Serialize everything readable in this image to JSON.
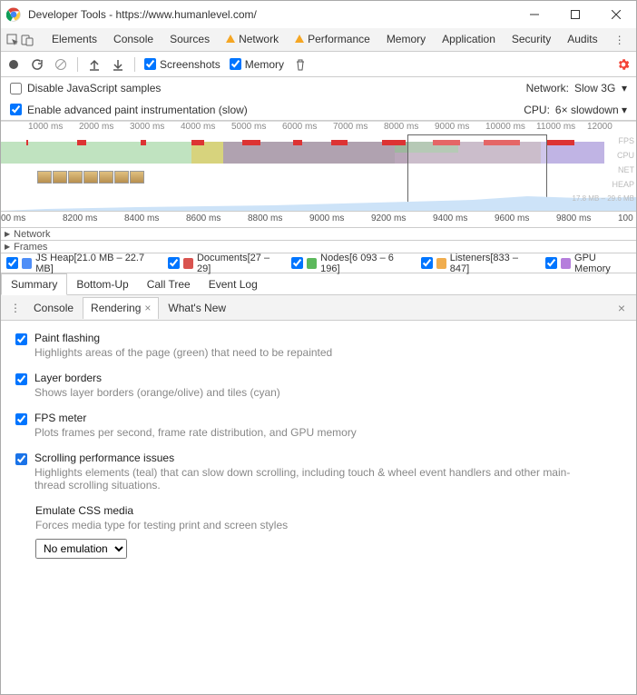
{
  "window": {
    "title": "Developer Tools - https://www.humanlevel.com/"
  },
  "mainTabs": [
    "Elements",
    "Console",
    "Sources",
    "Network",
    "Performance",
    "Memory",
    "Application",
    "Security",
    "Audits"
  ],
  "toolbar": {
    "screenshots": "Screenshots",
    "memory": "Memory"
  },
  "options": {
    "disableJs": "Disable JavaScript samples",
    "enablePaint": "Enable advanced paint instrumentation (slow)",
    "networkLabel": "Network:",
    "networkValue": "Slow 3G",
    "cpuLabel": "CPU:",
    "cpuValue": "6× slowdown"
  },
  "ruler1": [
    "1000 ms",
    "2000 ms",
    "3000 ms",
    "4000 ms",
    "5000 ms",
    "6000 ms",
    "7000 ms",
    "8000 ms",
    "9000 ms",
    "10000 ms",
    "11000 ms",
    "12000"
  ],
  "tlLabels": [
    "FPS",
    "CPU",
    "NET",
    "HEAP"
  ],
  "heapText": "17.8 MB – 29.6 MB",
  "ruler2": [
    "00 ms",
    "8200 ms",
    "8400 ms",
    "8600 ms",
    "8800 ms",
    "9000 ms",
    "9200 ms",
    "9400 ms",
    "9600 ms",
    "9800 ms",
    "100"
  ],
  "rows": {
    "network": "Network",
    "frames": "Frames"
  },
  "chips": [
    {
      "color": "#4f8ef7",
      "label": "JS Heap",
      "val": "[21.0 MB – 22.7 MB]"
    },
    {
      "color": "#d9534f",
      "label": "Documents",
      "val": "[27 – 29]"
    },
    {
      "color": "#5cb85c",
      "label": "Nodes",
      "val": "[6 093 – 6 196]"
    },
    {
      "color": "#f0ad4e",
      "label": "Listeners",
      "val": "[833 – 847]"
    },
    {
      "color": "#b57edc",
      "label": "GPU Memory",
      "val": ""
    }
  ],
  "subtabs": [
    "Summary",
    "Bottom-Up",
    "Call Tree",
    "Event Log"
  ],
  "drawerTabs": [
    "Console",
    "Rendering",
    "What's New"
  ],
  "rendering": {
    "paintFlash": {
      "t": "Paint flashing",
      "d": "Highlights areas of the page (green) that need to be repainted"
    },
    "layerBorders": {
      "t": "Layer borders",
      "d": "Shows layer borders (orange/olive) and tiles (cyan)"
    },
    "fpsMeter": {
      "t": "FPS meter",
      "d": "Plots frames per second, frame rate distribution, and GPU memory"
    },
    "scrollPerf": {
      "t": "Scrolling performance issues",
      "d": "Highlights elements (teal) that can slow down scrolling, including touch & wheel event handlers and other main-thread scrolling situations."
    },
    "emulate": {
      "t": "Emulate CSS media",
      "d": "Forces media type for testing print and screen styles",
      "sel": "No emulation"
    }
  }
}
